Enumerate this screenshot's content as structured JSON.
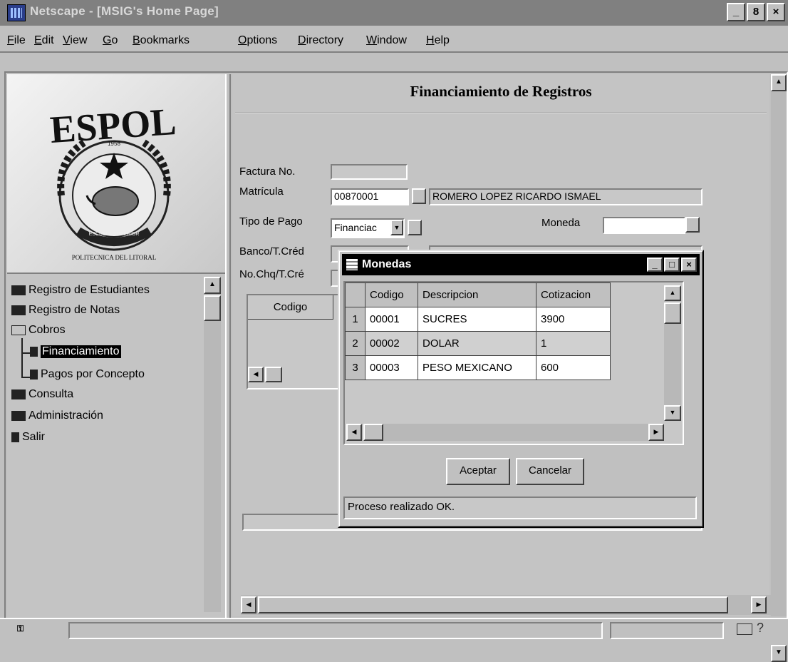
{
  "window": {
    "title": "Netscape - [MSIG's Home Page]",
    "min": "_",
    "restore": "8",
    "close": "×"
  },
  "menu": [
    "File",
    "Edit",
    "View",
    "Go",
    "Bookmarks",
    "Options",
    "Directory",
    "Window",
    "Help"
  ],
  "logo": {
    "name": "ESPOL",
    "year": "1958",
    "ribbon": "ESCUELA SUPERIOR",
    "motto": "POLITECNICA DEL LITORAL"
  },
  "nav": {
    "items": [
      {
        "label": "Registro de Estudiantes",
        "icon": "folder-closed-icon"
      },
      {
        "label": "Registro de Notas",
        "icon": "folder-closed-icon"
      },
      {
        "label": "Cobros",
        "icon": "folder-open-icon"
      },
      {
        "label": "Financiamiento",
        "icon": "document-icon"
      },
      {
        "label": "Pagos por Concepto",
        "icon": "document-icon"
      },
      {
        "label": "Consulta",
        "icon": "folder-closed-icon"
      },
      {
        "label": "Administración",
        "icon": "folder-closed-icon"
      },
      {
        "label": "Salir",
        "icon": "document-icon"
      }
    ],
    "selected": "Financiamiento"
  },
  "form": {
    "title": "Financiamiento de Registros",
    "factura_label": "Factura No.",
    "factura_value": "",
    "matricula_label": "Matrícula",
    "matricula_value": "00870001",
    "student_name": "ROMERO LOPEZ RICARDO ISMAEL",
    "tipo_pago_label": "Tipo de Pago",
    "tipo_pago_value": "Financiac",
    "moneda_label": "Moneda",
    "moneda_value": "",
    "banco_label": "Banco/T.Créd",
    "nochq_label": "No.Chq/T.Cré",
    "codigo_header": "Codigo"
  },
  "dialog": {
    "title": "Monedas",
    "columns": [
      "Codigo",
      "Descripcion",
      "Cotizacion"
    ],
    "rows": [
      {
        "n": "1",
        "codigo": "00001",
        "descripcion": "SUCRES",
        "cotizacion": "3900"
      },
      {
        "n": "2",
        "codigo": "00002",
        "descripcion": "DOLAR",
        "cotizacion": "1"
      },
      {
        "n": "3",
        "codigo": "00003",
        "descripcion": "PESO MEXICANO",
        "cotizacion": "600"
      }
    ],
    "accept_label": "Aceptar",
    "cancel_label": "Cancelar",
    "status": "Proceso realizado OK."
  },
  "statusbar": {
    "mail_icon": "mail-icon",
    "help_glyph": "?"
  }
}
